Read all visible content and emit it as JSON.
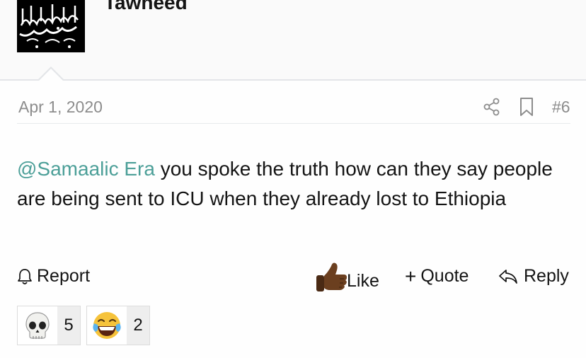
{
  "user": {
    "name": "Tawheed"
  },
  "post": {
    "date": "Apr 1, 2020",
    "number": "#6",
    "mention": "@Samaalic Era",
    "body": " you spoke the truth how can they say people are being sent to ICU when they already lost to Ethiopia"
  },
  "actions": {
    "report": "Report",
    "like": "Like",
    "quote": "Quote",
    "reply": "Reply"
  },
  "reactions": [
    {
      "emoji": "skull",
      "count": "5"
    },
    {
      "emoji": "face-with-tears-of-joy",
      "count": "2"
    }
  ],
  "colors": {
    "mention": "#4c9f98",
    "muted": "#8c8c8c",
    "divider": "#e3e5e8"
  }
}
